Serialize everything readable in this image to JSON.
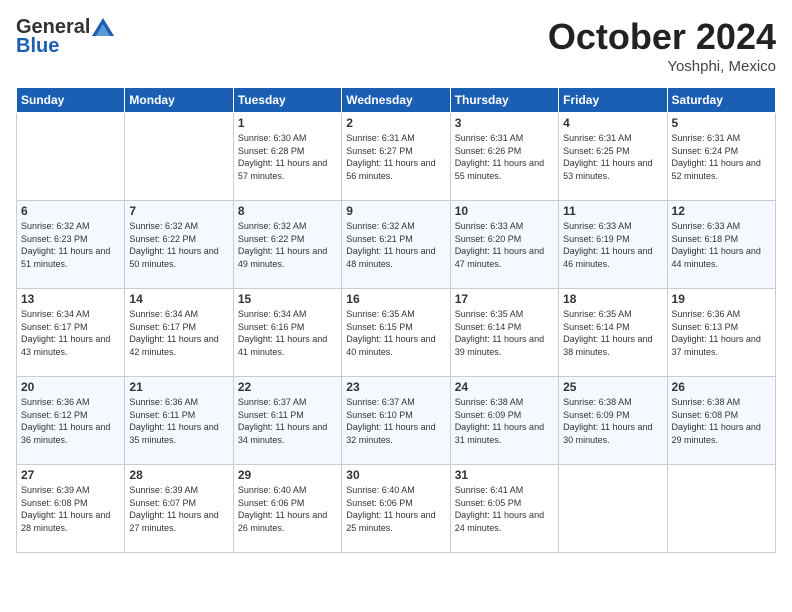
{
  "header": {
    "logo_line1": "General",
    "logo_line2": "Blue",
    "month": "October 2024",
    "location": "Yoshphi, Mexico"
  },
  "days_of_week": [
    "Sunday",
    "Monday",
    "Tuesday",
    "Wednesday",
    "Thursday",
    "Friday",
    "Saturday"
  ],
  "weeks": [
    [
      {
        "day": "",
        "info": ""
      },
      {
        "day": "",
        "info": ""
      },
      {
        "day": "1",
        "info": "Sunrise: 6:30 AM\nSunset: 6:28 PM\nDaylight: 11 hours and 57 minutes."
      },
      {
        "day": "2",
        "info": "Sunrise: 6:31 AM\nSunset: 6:27 PM\nDaylight: 11 hours and 56 minutes."
      },
      {
        "day": "3",
        "info": "Sunrise: 6:31 AM\nSunset: 6:26 PM\nDaylight: 11 hours and 55 minutes."
      },
      {
        "day": "4",
        "info": "Sunrise: 6:31 AM\nSunset: 6:25 PM\nDaylight: 11 hours and 53 minutes."
      },
      {
        "day": "5",
        "info": "Sunrise: 6:31 AM\nSunset: 6:24 PM\nDaylight: 11 hours and 52 minutes."
      }
    ],
    [
      {
        "day": "6",
        "info": "Sunrise: 6:32 AM\nSunset: 6:23 PM\nDaylight: 11 hours and 51 minutes."
      },
      {
        "day": "7",
        "info": "Sunrise: 6:32 AM\nSunset: 6:22 PM\nDaylight: 11 hours and 50 minutes."
      },
      {
        "day": "8",
        "info": "Sunrise: 6:32 AM\nSunset: 6:22 PM\nDaylight: 11 hours and 49 minutes."
      },
      {
        "day": "9",
        "info": "Sunrise: 6:32 AM\nSunset: 6:21 PM\nDaylight: 11 hours and 48 minutes."
      },
      {
        "day": "10",
        "info": "Sunrise: 6:33 AM\nSunset: 6:20 PM\nDaylight: 11 hours and 47 minutes."
      },
      {
        "day": "11",
        "info": "Sunrise: 6:33 AM\nSunset: 6:19 PM\nDaylight: 11 hours and 46 minutes."
      },
      {
        "day": "12",
        "info": "Sunrise: 6:33 AM\nSunset: 6:18 PM\nDaylight: 11 hours and 44 minutes."
      }
    ],
    [
      {
        "day": "13",
        "info": "Sunrise: 6:34 AM\nSunset: 6:17 PM\nDaylight: 11 hours and 43 minutes."
      },
      {
        "day": "14",
        "info": "Sunrise: 6:34 AM\nSunset: 6:17 PM\nDaylight: 11 hours and 42 minutes."
      },
      {
        "day": "15",
        "info": "Sunrise: 6:34 AM\nSunset: 6:16 PM\nDaylight: 11 hours and 41 minutes."
      },
      {
        "day": "16",
        "info": "Sunrise: 6:35 AM\nSunset: 6:15 PM\nDaylight: 11 hours and 40 minutes."
      },
      {
        "day": "17",
        "info": "Sunrise: 6:35 AM\nSunset: 6:14 PM\nDaylight: 11 hours and 39 minutes."
      },
      {
        "day": "18",
        "info": "Sunrise: 6:35 AM\nSunset: 6:14 PM\nDaylight: 11 hours and 38 minutes."
      },
      {
        "day": "19",
        "info": "Sunrise: 6:36 AM\nSunset: 6:13 PM\nDaylight: 11 hours and 37 minutes."
      }
    ],
    [
      {
        "day": "20",
        "info": "Sunrise: 6:36 AM\nSunset: 6:12 PM\nDaylight: 11 hours and 36 minutes."
      },
      {
        "day": "21",
        "info": "Sunrise: 6:36 AM\nSunset: 6:11 PM\nDaylight: 11 hours and 35 minutes."
      },
      {
        "day": "22",
        "info": "Sunrise: 6:37 AM\nSunset: 6:11 PM\nDaylight: 11 hours and 34 minutes."
      },
      {
        "day": "23",
        "info": "Sunrise: 6:37 AM\nSunset: 6:10 PM\nDaylight: 11 hours and 32 minutes."
      },
      {
        "day": "24",
        "info": "Sunrise: 6:38 AM\nSunset: 6:09 PM\nDaylight: 11 hours and 31 minutes."
      },
      {
        "day": "25",
        "info": "Sunrise: 6:38 AM\nSunset: 6:09 PM\nDaylight: 11 hours and 30 minutes."
      },
      {
        "day": "26",
        "info": "Sunrise: 6:38 AM\nSunset: 6:08 PM\nDaylight: 11 hours and 29 minutes."
      }
    ],
    [
      {
        "day": "27",
        "info": "Sunrise: 6:39 AM\nSunset: 6:08 PM\nDaylight: 11 hours and 28 minutes."
      },
      {
        "day": "28",
        "info": "Sunrise: 6:39 AM\nSunset: 6:07 PM\nDaylight: 11 hours and 27 minutes."
      },
      {
        "day": "29",
        "info": "Sunrise: 6:40 AM\nSunset: 6:06 PM\nDaylight: 11 hours and 26 minutes."
      },
      {
        "day": "30",
        "info": "Sunrise: 6:40 AM\nSunset: 6:06 PM\nDaylight: 11 hours and 25 minutes."
      },
      {
        "day": "31",
        "info": "Sunrise: 6:41 AM\nSunset: 6:05 PM\nDaylight: 11 hours and 24 minutes."
      },
      {
        "day": "",
        "info": ""
      },
      {
        "day": "",
        "info": ""
      }
    ]
  ]
}
